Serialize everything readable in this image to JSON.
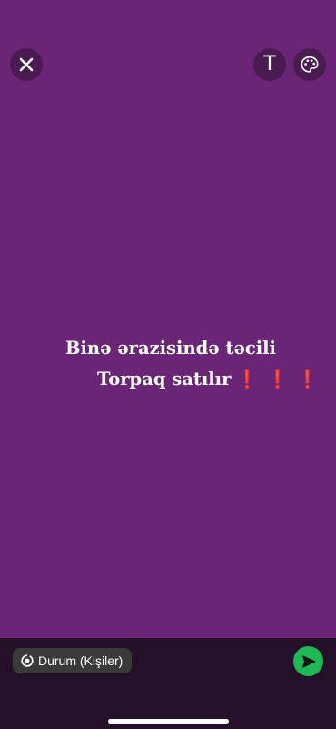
{
  "status_post": {
    "line1": "Binə ərazisində təcili",
    "line2": "Torpaq satılır",
    "exclamations": "❗❗❗"
  },
  "toolbar": {
    "text_glyph": "T"
  },
  "footer": {
    "audience_label": "Durum (Kişiler)"
  },
  "icons": {
    "close": "close-icon",
    "text": "text-tool-icon",
    "palette": "palette-icon",
    "audience": "status-ring-icon",
    "send": "send-icon"
  },
  "colors": {
    "background": "#6b2577",
    "bottom_bar": "#25102a",
    "send_button": "#1fb855",
    "exclamation": "#e0162b"
  }
}
